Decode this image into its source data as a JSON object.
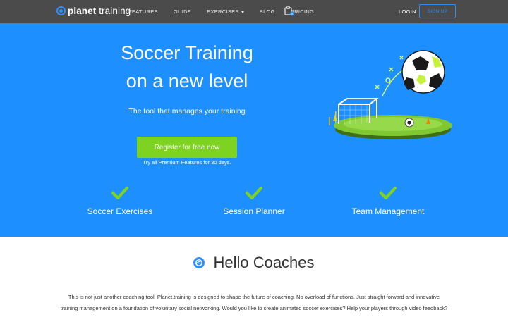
{
  "nav": {
    "brand_bold": "planet",
    "brand_rest": " training",
    "links": [
      "FEATURES",
      "GUIDE",
      "EXERCISES",
      "BLOG",
      "PRICING"
    ],
    "login": "LOGIN",
    "signup": "SIGN UP",
    "clipboard_badge": "0"
  },
  "hero": {
    "title_line1": "Soccer Training",
    "title_line2": "on a new level",
    "subtitle": "The tool that manages your training",
    "register_button": "Register for free now",
    "trial_note": "Try all Premium Features for 30 days.",
    "features": [
      "Soccer Exercises",
      "Session Planner",
      "Team Management"
    ]
  },
  "content": {
    "heading": "Hello Coaches",
    "intro_line1": "This is not just another coaching tool. Planet.training is designed to shape the future of coaching. No overload of functions. Just straight forward and innovative",
    "intro_line2": "training management on a foundation of voluntary social networking. Would you like to create animated soccer exercises? Help your players through video feedback?"
  },
  "colors": {
    "nav_bg": "#4b4b4b",
    "hero_bg": "#1e8fff",
    "register_green": "#7ed321",
    "check_green": "#7ed321",
    "accent_blue": "#2f8fff"
  },
  "icons": [
    "planet-logo-icon",
    "clipboard-icon",
    "soccer-ball-icon",
    "checkmark-icon",
    "planet-icon"
  ]
}
